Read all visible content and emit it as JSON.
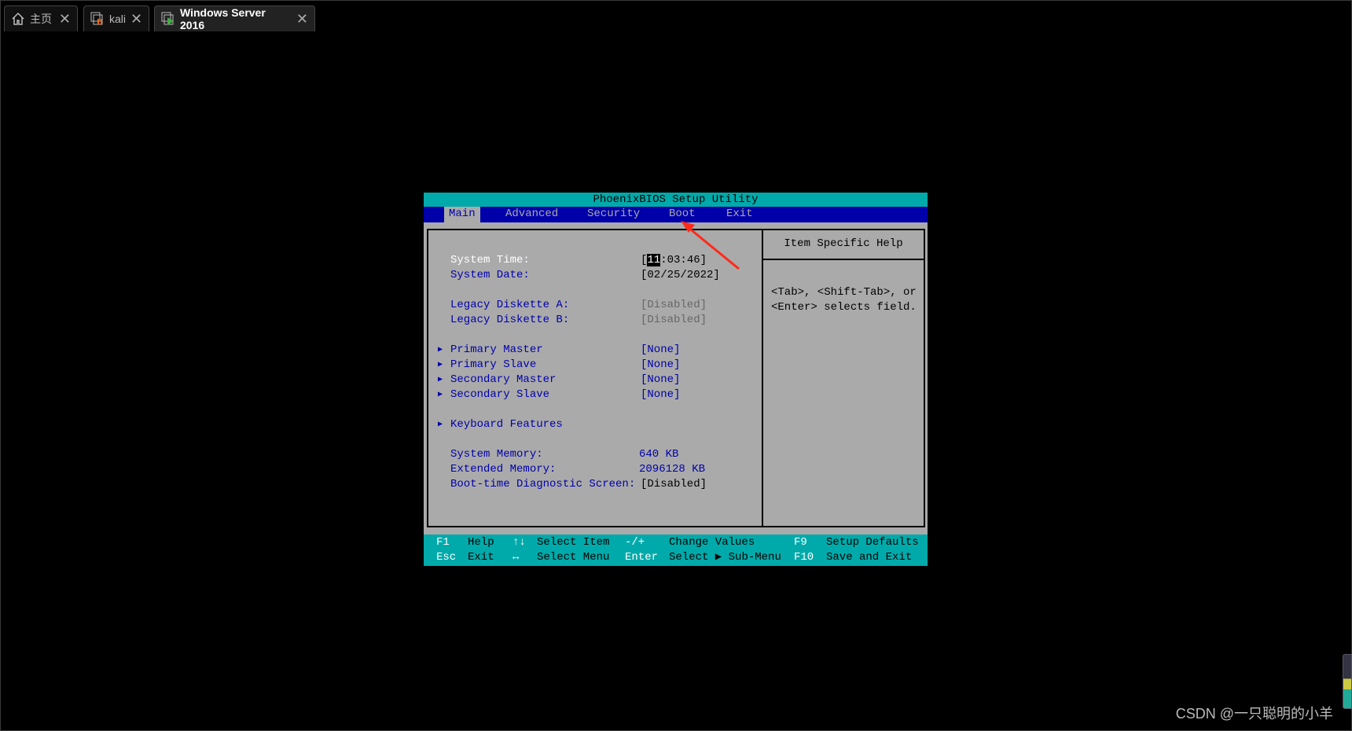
{
  "tabs": [
    {
      "label": "主页",
      "icon": "home-icon"
    },
    {
      "label": "kali",
      "icon": "vm-icon"
    },
    {
      "label": "Windows Server 2016",
      "icon": "vm-running-icon",
      "active": true
    }
  ],
  "bios": {
    "title": "PhoenixBIOS Setup Utility",
    "menu": [
      "Main",
      "Advanced",
      "Security",
      "Boot",
      "Exit"
    ],
    "rows": [
      {
        "label": "System Time:",
        "value_pre": "[",
        "value_hl": "11",
        "value_post": ":03:46]"
      },
      {
        "label": "System Date:",
        "value": "[02/25/2022]"
      },
      {
        "label": "Legacy Diskette A:",
        "value": "[Disabled]"
      },
      {
        "label": "Legacy Diskette B:",
        "value": "[Disabled]"
      },
      {
        "label": "Primary Master",
        "value": "[None]"
      },
      {
        "label": "Primary Slave",
        "value": "[None]"
      },
      {
        "label": "Secondary Master",
        "value": "[None]"
      },
      {
        "label": "Secondary Slave",
        "value": "[None]"
      },
      {
        "label": "Keyboard Features"
      },
      {
        "label": "System Memory:",
        "value": "640 KB"
      },
      {
        "label": "Extended Memory:",
        "value": "2096128 KB"
      },
      {
        "label": "Boot-time Diagnostic Screen:",
        "value": "[Disabled]"
      }
    ],
    "help_title": "Item Specific Help",
    "help_text": "<Tab>, <Shift-Tab>, or\n<Enter> selects field.",
    "footer": [
      [
        "F1",
        "Help",
        "↑↓",
        "Select Item",
        "-/+",
        "Change Values",
        "F9",
        "Setup Defaults"
      ],
      [
        "Esc",
        "Exit",
        "↔",
        "Select Menu",
        "Enter",
        "Select ▶ Sub-Menu",
        "F10",
        "Save and Exit"
      ]
    ]
  },
  "watermark": "CSDN @一只聪明的小羊",
  "colors": {
    "teal": "#00aaaa",
    "blue": "#0000aa",
    "gray": "#aaaaaa",
    "arrow": "#ff2a1a"
  }
}
